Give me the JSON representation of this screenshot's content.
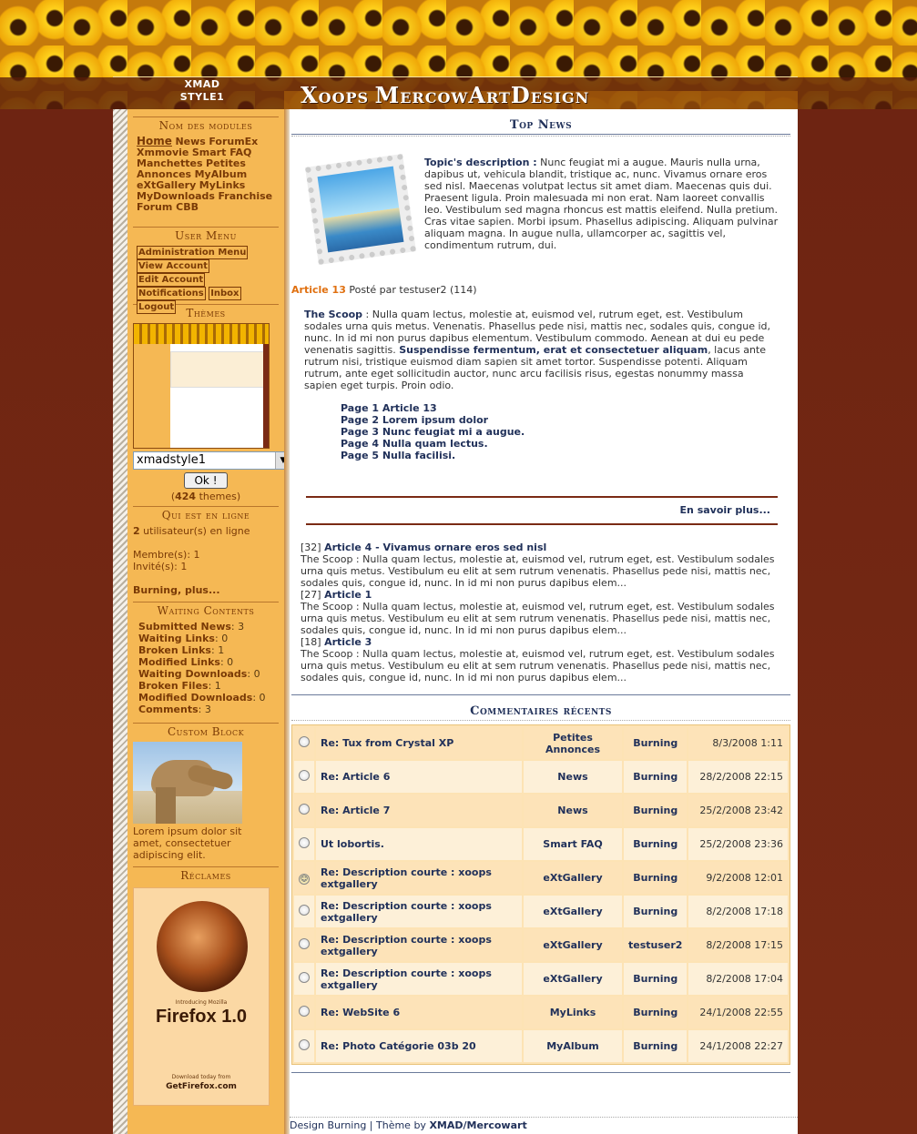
{
  "header": {
    "xmad_line1": "XMAD",
    "xmad_line2": "STYLE1",
    "site_title_parts": [
      "X",
      "OOPS ",
      "M",
      "ERCOW",
      "A",
      "RT",
      "D",
      "ESIGN"
    ]
  },
  "left": {
    "modules_title": "Nom des modules",
    "modules": [
      "Home",
      "News",
      "ForumEx",
      "Xmmovie",
      "Smart FAQ",
      "Manchettes",
      "Petites Annonces",
      "MyAlbum",
      "eXtGallery",
      "MyLinks",
      "MyDownloads",
      "Franchise",
      "Forum CBB"
    ],
    "user_title": "User Menu",
    "user_items": [
      "Administration Menu",
      "View Account",
      "Edit Account",
      "Notifications",
      "Inbox",
      "Logout"
    ],
    "themes_title": "Thèmes",
    "theme_select": "xmadstyle1",
    "theme_ok": "Ok !",
    "theme_count_open": "(",
    "theme_count": "424",
    "theme_count_rest": " themes)",
    "online_title": "Qui est en ligne",
    "online_count": "2",
    "online_text": " utilisateur(s) en ligne",
    "members": "Membre(s): 1",
    "guests": "Invité(s): 1",
    "online_more": "Burning, plus...",
    "waiting_title": "Waiting Contents",
    "waiting": [
      {
        "label": "Submitted News",
        "value": "3"
      },
      {
        "label": "Waiting Links",
        "value": "0"
      },
      {
        "label": "Broken Links",
        "value": "1"
      },
      {
        "label": "Modified Links",
        "value": "0"
      },
      {
        "label": "Waiting Downloads",
        "value": "0"
      },
      {
        "label": "Broken Files",
        "value": "1"
      },
      {
        "label": "Modified Downloads",
        "value": "0"
      },
      {
        "label": "Comments",
        "value": "3"
      }
    ],
    "custom_title": "Custom Block",
    "custom_text": "Lorem ipsum dolor sit amet, consectetuer adipiscing elit.",
    "ads_title": "Réclames",
    "ad_brand": "Firefox 1.0",
    "ad_tagline": "Introducing Mozilla",
    "ad_footer": "GetFirefox.com",
    "ad_download": "Download today from"
  },
  "main": {
    "top_title": "Top News",
    "topic_label": "Topic's description :",
    "topic_text": " Nunc feugiat mi a augue. Mauris nulla urna, dapibus ut, vehicula blandit, tristique ac, nunc. Vivamus ornare eros sed nisl. Maecenas volutpat lectus sit amet diam. Maecenas quis dui. Praesent ligula. Proin malesuada mi non erat. Nam laoreet convallis leo. Vestibulum sed magna rhoncus est mattis eleifend. Nulla pretium. Cras vitae sapien. Morbi ipsum. Phasellus adipiscing. Aliquam pulvinar aliquam magna. In augue nulla, ullamcorper ac, sagittis vel, condimentum rutrum, dui.",
    "article_title": "Article 13",
    "article_meta": " Posté par testuser2 (114)",
    "scoop_label": "The Scoop",
    "scoop_text1": " : Nulla quam lectus, molestie at, euismod vel, rutrum eget, est. Vestibulum sodales urna quis metus. Venenatis. Phasellus pede nisi, mattis nec, sodales quis, congue id, nunc. In id mi non purus dapibus elementum. Vestibulum commodo. Aenean at dui eu pede venenatis sagittis. ",
    "scoop_bold": "Suspendisse fermentum, erat et consectetuer aliquam",
    "scoop_text2": ", lacus ante rutrum nisi, tristique euismod diam sapien sit amet tortor. Suspendisse potenti. Aliquam rutrum, ante eget sollicitudin auctor, nunc arcu facilisis risus, egestas nonummy massa sapien eget turpis. Proin odio.",
    "pages": [
      "Page 1 Article 13",
      "Page 2 Lorem ipsum dolor",
      "Page 3 Nunc feugiat mi a augue.",
      "Page 4 Nulla quam lectus.",
      "Page 5 Nulla facilisi."
    ],
    "more": "En savoir plus...",
    "others": [
      {
        "count": "[32]",
        "title": "Article 4 - Vivamus ornare eros sed nisl",
        "text": "The Scoop : Nulla quam lectus, molestie at, euismod vel, rutrum eget, est. Vestibulum sodales urna quis metus. Vestibulum eu elit at sem rutrum venenatis. Phasellus pede nisi, mattis nec, sodales quis, congue id, nunc. In id mi non purus dapibus elem..."
      },
      {
        "count": "[27]",
        "title": "Article 1",
        "text": "The Scoop : Nulla quam lectus, molestie at, euismod vel, rutrum eget, est. Vestibulum sodales urna quis metus. Vestibulum eu elit at sem rutrum venenatis. Phasellus pede nisi, mattis nec, sodales quis, congue id, nunc. In id mi non purus dapibus elem..."
      },
      {
        "count": "[18]",
        "title": "Article 3",
        "text": "The Scoop : Nulla quam lectus, molestie at, euismod vel, rutrum eget, est. Vestibulum sodales urna quis metus. Vestibulum eu elit at sem rutrum venenatis. Phasellus pede nisi, mattis nec, sodales quis, congue id, nunc. In id mi non purus dapibus elem..."
      }
    ],
    "comments_title": "Commentaires récents",
    "comments": [
      {
        "title": "Re: Tux from Crystal XP",
        "module": "Petites Annonces",
        "user": "Burning",
        "date": "8/3/2008 1:11",
        "smile": false
      },
      {
        "title": "Re: Article 6",
        "module": "News",
        "user": "Burning",
        "date": "28/2/2008 22:15",
        "smile": false
      },
      {
        "title": "Re: Article 7",
        "module": "News",
        "user": "Burning",
        "date": "25/2/2008 23:42",
        "smile": false
      },
      {
        "title": "Ut lobortis.",
        "module": "Smart FAQ",
        "user": "Burning",
        "date": "25/2/2008 23:36",
        "smile": false
      },
      {
        "title": "Re: Description courte : xoops extgallery",
        "module": "eXtGallery",
        "user": "Burning",
        "date": "9/2/2008 12:01",
        "smile": true
      },
      {
        "title": "Re: Description courte : xoops extgallery",
        "module": "eXtGallery",
        "user": "Burning",
        "date": "8/2/2008 17:18",
        "smile": false
      },
      {
        "title": "Re: Description courte : xoops extgallery",
        "module": "eXtGallery",
        "user": "testuser2",
        "date": "8/2/2008 17:15",
        "smile": false
      },
      {
        "title": "Re: Description courte : xoops extgallery",
        "module": "eXtGallery",
        "user": "Burning",
        "date": "8/2/2008 17:04",
        "smile": false
      },
      {
        "title": "Re: WebSite 6",
        "module": "MyLinks",
        "user": "Burning",
        "date": "24/1/2008 22:55",
        "smile": false
      },
      {
        "title": "Re: Photo Catégorie 03b 20",
        "module": "MyAlbum",
        "user": "Burning",
        "date": "24/1/2008 22:27",
        "smile": false
      }
    ]
  },
  "footer": {
    "text": "Design Burning | Thème by ",
    "author": "XMAD/Mercowart"
  },
  "colors": {
    "bg": "#7a2a14",
    "sidebar": "#f5b854",
    "link_blue": "#21315a",
    "accent": "#e07010"
  }
}
